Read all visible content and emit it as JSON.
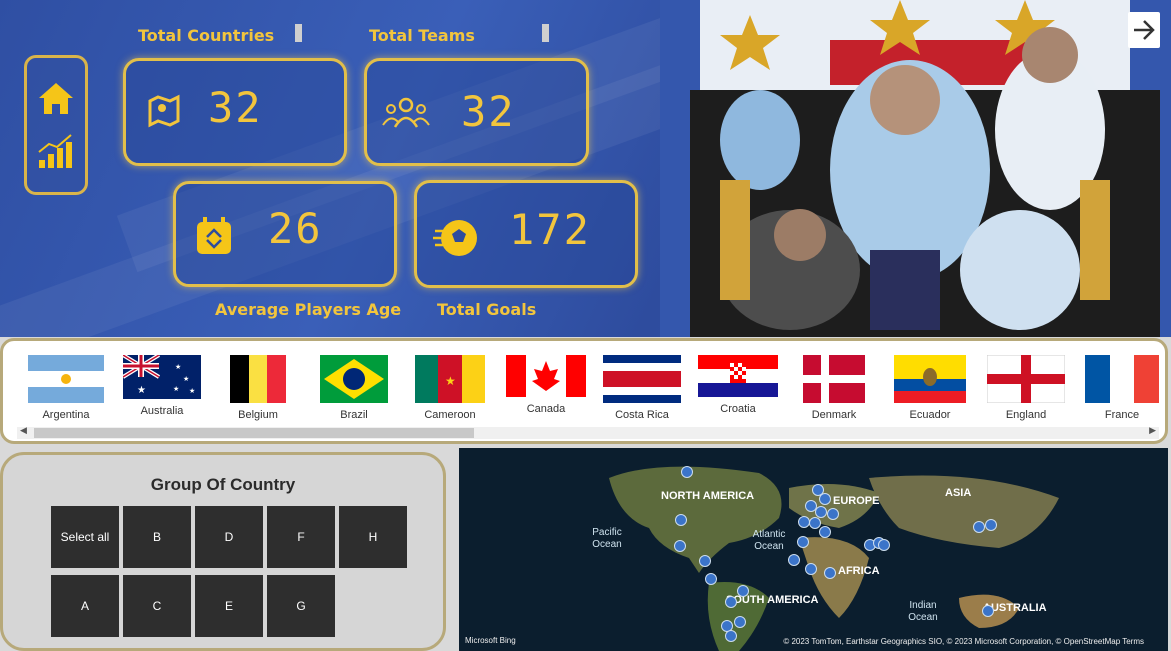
{
  "kpis": {
    "total_countries": {
      "title": "Total Countries",
      "value": "32",
      "icon": "map-icon"
    },
    "total_teams": {
      "title": "Total Teams",
      "value": "32",
      "icon": "team-icon"
    },
    "avg_age": {
      "title": "Average Players Age",
      "value": "26",
      "icon": "calendar-icon"
    },
    "total_goals": {
      "title": "Total Goals",
      "value": "172",
      "icon": "ball-icon"
    }
  },
  "nav": {
    "home": "home-icon",
    "analytics": "chart-icon",
    "next": "arrow-right-icon"
  },
  "flags": [
    {
      "label": "Argentina"
    },
    {
      "label": "Australia"
    },
    {
      "label": "Belgium"
    },
    {
      "label": "Brazil"
    },
    {
      "label": "Cameroon"
    },
    {
      "label": "Canada"
    },
    {
      "label": "Costa Rica"
    },
    {
      "label": "Croatia"
    },
    {
      "label": "Denmark"
    },
    {
      "label": "Ecuador"
    },
    {
      "label": "England"
    },
    {
      "label": "France"
    }
  ],
  "group_slicer": {
    "title": "Group Of Country",
    "buttons": [
      "Select all",
      "B",
      "D",
      "F",
      "H",
      "A",
      "C",
      "E",
      "G"
    ]
  },
  "map": {
    "continents": [
      "NORTH AMERICA",
      "EUROPE",
      "ASIA",
      "AFRICA",
      "SOUTH AMERICA",
      "AUSTRALIA"
    ],
    "oceans": [
      "Pacific Ocean",
      "Atlantic Ocean",
      "Indian Ocean"
    ],
    "bing": "Microsoft Bing",
    "credit": "© 2023 TomTom, Earthstar Geographics SIO, © 2023 Microsoft Corporation, © OpenStreetMap   Terms"
  },
  "colors": {
    "gold": "#f2c53d",
    "banner": "#2f4fa3",
    "slicer_btn": "#2e2e2e",
    "dot": "#3b74c9"
  }
}
